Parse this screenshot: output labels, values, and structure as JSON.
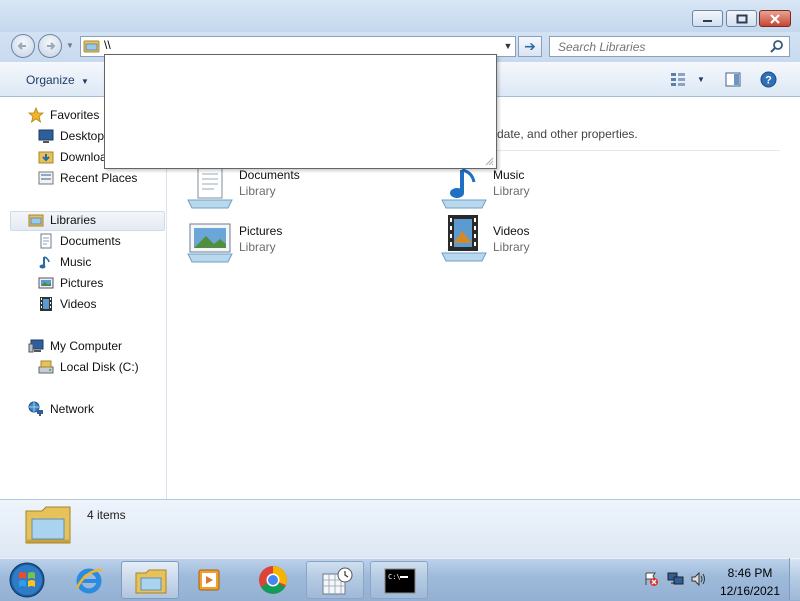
{
  "window": {
    "minimize_icon": "minimize-icon",
    "maximize_icon": "maximize-icon",
    "close_icon": "close-icon"
  },
  "addressbar": {
    "value": "\\\\",
    "search_placeholder": "Search Libraries"
  },
  "toolbar": {
    "organize_label": "Organize",
    "view_icon": "change-view-icon",
    "preview_icon": "preview-pane-icon",
    "help_icon": "help-icon"
  },
  "nav": {
    "favorites": "Favorites",
    "desktop": "Desktop",
    "downloads": "Downloads",
    "recent_places": "Recent Places",
    "libraries": "Libraries",
    "documents": "Documents",
    "music": "Music",
    "pictures": "Pictures",
    "videos": "Videos",
    "my_computer": "My Computer",
    "local_disk": "Local Disk (C:)",
    "network": "Network"
  },
  "content": {
    "header_fragment": "date, and other properties.",
    "libraries": [
      {
        "name": "Documents",
        "type": "Library"
      },
      {
        "name": "Music",
        "type": "Library"
      },
      {
        "name": "Pictures",
        "type": "Library"
      },
      {
        "name": "Videos",
        "type": "Library"
      }
    ]
  },
  "details": {
    "count": "4 items"
  },
  "taskbar": {
    "time": "8:46 PM",
    "date": "12/16/2021"
  },
  "colors": {
    "accent": "#2b6aa8",
    "window_frame": "#c4d8ee",
    "taskbar": "#9fbbdb"
  }
}
